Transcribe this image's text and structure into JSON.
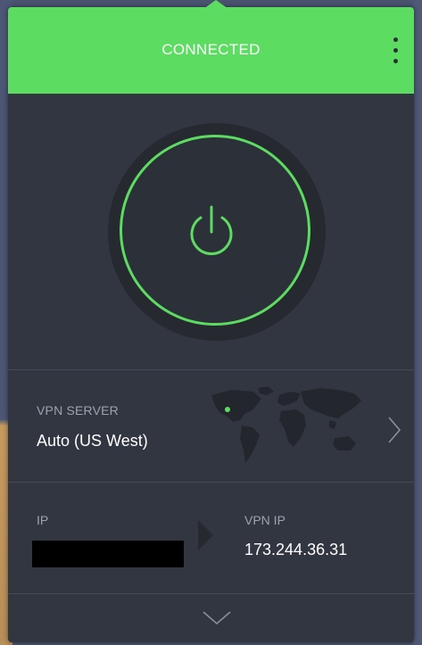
{
  "header": {
    "status": "CONNECTED",
    "menu_icon": "more-vertical-icon"
  },
  "colors": {
    "accent": "#5ddc62",
    "panel": "#323641",
    "muted_text": "#9da3ae"
  },
  "power": {
    "icon": "power-icon",
    "state": "on"
  },
  "server": {
    "label": "VPN SERVER",
    "value": "Auto (US West)",
    "map_icon": "world-map-icon",
    "next_icon": "chevron-right-icon"
  },
  "ip": {
    "label": "IP",
    "value_redacted": true
  },
  "vpn_ip": {
    "label": "VPN IP",
    "value": "173.244.36.31"
  },
  "footer": {
    "expand_icon": "chevron-down-icon"
  }
}
